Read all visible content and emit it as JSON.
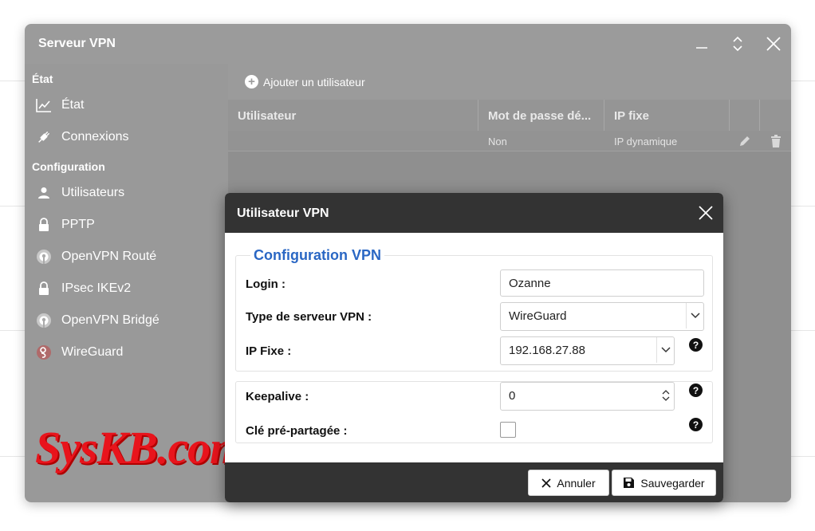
{
  "window": {
    "title": "Serveur VPN"
  },
  "sidebar": {
    "section_state": "État",
    "section_config": "Configuration",
    "items": [
      {
        "label": "État",
        "icon": "chart-line-icon"
      },
      {
        "label": "Connexions",
        "icon": "plug-icon"
      },
      {
        "label": "Utilisateurs",
        "icon": "user-icon"
      },
      {
        "label": "PPTP",
        "icon": "lock-icon"
      },
      {
        "label": "OpenVPN Routé",
        "icon": "openvpn-icon"
      },
      {
        "label": "IPsec IKEv2",
        "icon": "lock-icon"
      },
      {
        "label": "OpenVPN Bridgé",
        "icon": "openvpn-icon"
      },
      {
        "label": "WireGuard",
        "icon": "wireguard-icon"
      }
    ]
  },
  "toolbar": {
    "add_user_label": "Ajouter un utilisateur"
  },
  "table": {
    "columns": [
      "Utilisateur",
      "Mot de passe dé...",
      "IP fixe",
      "",
      ""
    ],
    "rows": [
      {
        "user": "",
        "password": "Non",
        "ip": "IP dynamique"
      }
    ]
  },
  "watermark": "SysKB.com",
  "dialog": {
    "title": "Utilisateur VPN",
    "legend": "Configuration VPN",
    "fields": {
      "login_label": "Login :",
      "login_value": "Ozanne",
      "type_label": "Type de serveur VPN :",
      "type_value": "WireGuard",
      "ip_label": "IP Fixe :",
      "ip_value": "192.168.27.88",
      "keepalive_label": "Keepalive :",
      "keepalive_value": "0",
      "psk_label": "Clé pré-partagée :",
      "psk_checked": false
    },
    "help_glyph": "?",
    "cancel_label": "Annuler",
    "save_label": "Sauvegarder"
  },
  "colors": {
    "titlebar": "#9b9b9b",
    "sidebar": "#999999",
    "dialog_header": "#333333",
    "legend": "#2a67c4",
    "watermark": "#e8141c"
  }
}
